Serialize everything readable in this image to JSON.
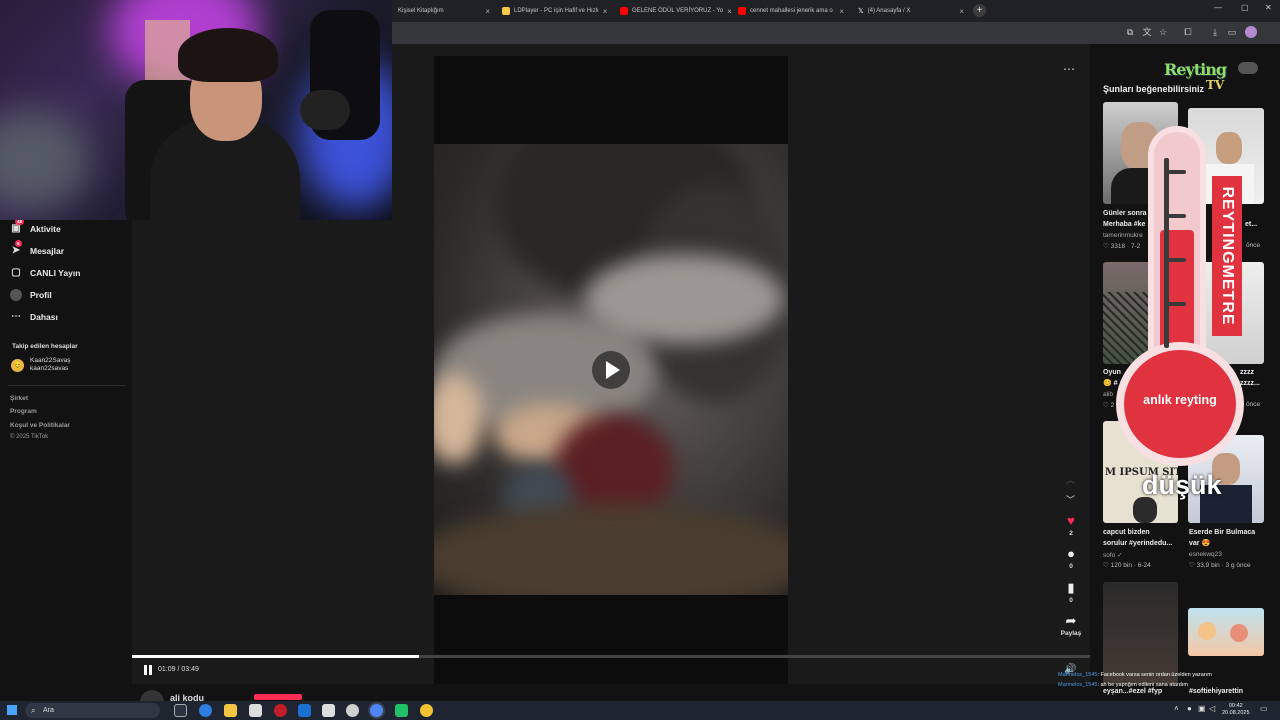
{
  "browser": {
    "tabs": [
      {
        "label": "Kişisel Kitaplığım",
        "fav": "#8ab4f8"
      },
      {
        "label": "LDPlayer - PC için Hafif ve Hızlı",
        "fav": "#f7c948"
      },
      {
        "label": "GELENE ÖDÜL VERİYORUZ - Yo",
        "fav": "#ff0000"
      },
      {
        "label": "cennet mahallesi jenerik ama o",
        "fav": "#ff0000"
      },
      {
        "label": "(4) Anasayfa / X",
        "fav": "#ffffff"
      }
    ],
    "new_tab": "+",
    "window_controls": [
      "—",
      "▢",
      "✕"
    ]
  },
  "sidebar": {
    "items": [
      {
        "label": "Aktivite",
        "icon": "inbox-icon",
        "badge": "48"
      },
      {
        "label": "Mesajlar",
        "icon": "paper-plane-icon",
        "badge": "5"
      },
      {
        "label": "CANLI Yayın",
        "icon": "live-tv-icon"
      },
      {
        "label": "Profil",
        "icon": "profile-icon"
      },
      {
        "label": "Dahası",
        "icon": "more-dots-icon"
      }
    ],
    "following_title": "Takip edilen hesaplar",
    "following": [
      {
        "name": "Kaan22Savaş",
        "handle": "kaan22savas",
        "emoji": "😊"
      }
    ],
    "footer": [
      "Şirket",
      "Program",
      "Koşul ve Politikalar",
      "© 2025 TikTok"
    ]
  },
  "player": {
    "time": "01:09 / 03:49",
    "progress": 0.3,
    "likes": "2",
    "comments": "0",
    "saves": "0",
    "share_label": "Paylaş",
    "below_title": "ali kodu"
  },
  "suggestions": {
    "title": "Şunları beğenebilirsiniz",
    "cards": [
      {
        "caption1": "Günler sonra",
        "caption2": "Merhaba #ke",
        "user": "tamerinmukre",
        "stat": "♡ 3318 · 7-2"
      },
      {
        "caption1": "",
        "caption2": "et...",
        "user": "",
        "stat": "önce"
      },
      {
        "caption1": "Oyun",
        "caption2": "😊 #",
        "user": "alib",
        "stat": "♡ 2"
      },
      {
        "caption1": "zzzz",
        "caption2": "zzzz...",
        "user": "",
        "stat": "önce"
      },
      {
        "caption1": "capcut bizden",
        "caption2": "sorulur #yerindedu...",
        "user": "sofo ✓",
        "stat": "♡ 120 bin · 6-24"
      },
      {
        "caption1": "Eserde Bir Bulmaca",
        "caption2": "var 😍",
        "user": "esnekwq23",
        "stat": "♡ 33,9 bin · 3 g önce"
      },
      {
        "caption1": "eyşan...#ezel #fyp",
        "caption2": "",
        "user": "",
        "stat": ""
      },
      {
        "caption1": "#softiehiyarettin",
        "caption2": "",
        "user": "",
        "stat": ""
      }
    ],
    "thumb_text": "M IPSUM SIT A"
  },
  "overlay": {
    "logo_top": "Reyting",
    "logo_bottom": "TV",
    "vertical_label": "REYTINGMETRE",
    "bulb_label": "anlık reyting",
    "level_label": "düşük",
    "level": 0.35
  },
  "chat": [
    {
      "user": "Marmelos_1545",
      "text": ": Facebook varsa senin ordan üzelden yazarım"
    },
    {
      "user": "Marmelos_1545",
      "text": ": ah be yapnğım ediieni sana atardım"
    }
  ],
  "taskbar": {
    "search_placeholder": "Ara",
    "time": "00:42",
    "date": "20.08.2025"
  }
}
